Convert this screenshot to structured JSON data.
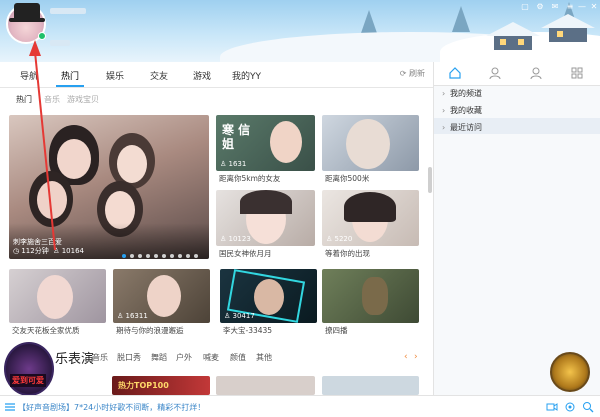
{
  "header": {
    "window_controls": [
      "▢",
      "⚙",
      "✉",
      "≡",
      "—",
      "✕"
    ]
  },
  "topnav": {
    "tabs": [
      "导航",
      "热门",
      "娱乐",
      "交友",
      "游戏",
      "我的YY"
    ],
    "refresh_label": "刷新"
  },
  "subnav": {
    "tabs": [
      "热门",
      "音乐",
      "游戏宝贝"
    ]
  },
  "featured": {
    "title": "刺李施舍三百爱",
    "time": "112分钟",
    "viewers": "10164"
  },
  "grid_top": [
    {
      "badge": "1631",
      "subtitle": "距离你5km的女友",
      "overlay_text": "寒 信 姐"
    },
    {
      "badge": "",
      "subtitle": "距离你500米",
      "overlay_text": ""
    },
    {
      "badge": "10123",
      "subtitle": "国民女神依月月",
      "overlay_text": ""
    },
    {
      "badge": "5220",
      "subtitle": "等着你的出现",
      "overlay_text": ""
    }
  ],
  "grid_bottom": [
    {
      "badge": "",
      "subtitle": "交友天花板全家优质"
    },
    {
      "badge": "16311",
      "subtitle": "期待与你的浪漫邂逅"
    },
    {
      "badge": "30417",
      "subtitle": "李大宝-33435"
    },
    {
      "badge": "",
      "subtitle": "撩四播"
    }
  ],
  "section": {
    "title": "乐表演",
    "categories": [
      "音乐",
      "脱口秀",
      "舞蹈",
      "户外",
      "喊麦",
      "颜值",
      "其他"
    ],
    "prev": "‹",
    "next": "›",
    "banner_text": "热力TOP100"
  },
  "rightpanel": {
    "items": [
      "我的频道",
      "我的收藏",
      "最近访问"
    ]
  },
  "bottombar": {
    "message": "【好声音剧场】7*24小时好歌不间断，精彩不打烊！"
  },
  "live_badge": {
    "text": "爱到可爱"
  },
  "colors": {
    "accent": "#27a0f0",
    "header_sky": "#9fd0f0",
    "arrow": "#e53935"
  }
}
